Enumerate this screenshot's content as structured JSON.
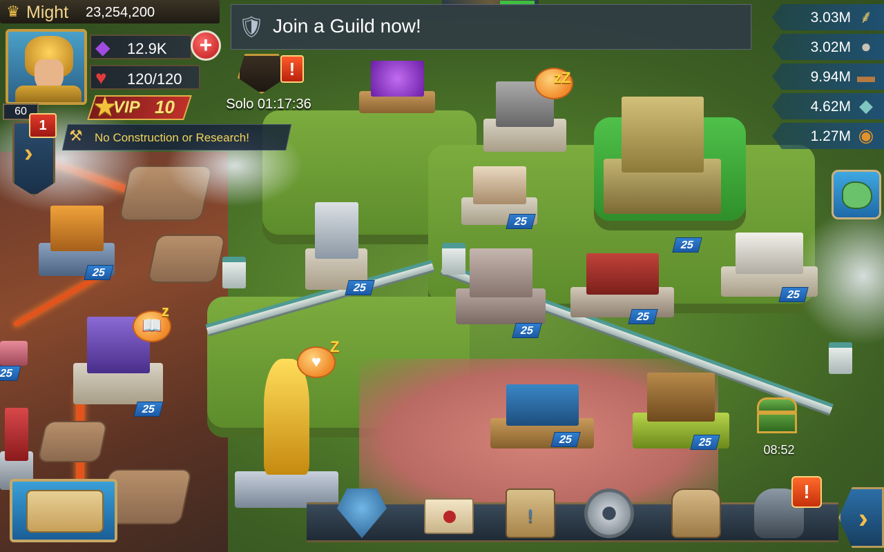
{
  "hud": {
    "might": {
      "label": "Might",
      "value": "23,254,200",
      "icon": "crown-icon"
    },
    "gems": {
      "value": "12.9K",
      "icon": "gem-icon"
    },
    "stamina": {
      "value": "120/120",
      "icon": "heart-icon"
    },
    "player_level": "60",
    "vip": {
      "label": "VIP",
      "level": "10"
    },
    "notification_count": "1",
    "construction_status": "No Construction or Research!",
    "guild_banner": "Join a Guild now!",
    "solo_event": "Solo 01:17:36"
  },
  "resources": [
    {
      "name": "food",
      "value": "3.03M",
      "icon": "wheat-icon"
    },
    {
      "name": "stone",
      "value": "3.02M",
      "icon": "stone-icon"
    },
    {
      "name": "timber",
      "value": "9.94M",
      "icon": "log-icon"
    },
    {
      "name": "ore",
      "value": "4.62M",
      "icon": "ore-icon"
    },
    {
      "name": "gold",
      "value": "1.27M",
      "icon": "gold-coin-icon"
    }
  ],
  "buildings": [
    {
      "name": "forge",
      "level": "25"
    },
    {
      "name": "watchtower",
      "level": "25"
    },
    {
      "name": "manor",
      "level": "25"
    },
    {
      "name": "guild-hall",
      "level": "25"
    },
    {
      "name": "trading-post",
      "level": "25"
    },
    {
      "name": "castle",
      "level": "25"
    },
    {
      "name": "barracks",
      "level": "25"
    },
    {
      "name": "infirmary",
      "level": "25"
    },
    {
      "name": "academy",
      "level": "25"
    },
    {
      "name": "lumber-mill",
      "level": "25"
    },
    {
      "name": "farm",
      "level": "25"
    },
    {
      "name": "left-edge-building",
      "level": "25"
    }
  ],
  "chest_timer": "08:52",
  "colors": {
    "level_badge": "#2f7fd1",
    "hud_gold": "#f2d58a",
    "alert_red": "#c5300c",
    "construction_text": "#f2d35a"
  }
}
